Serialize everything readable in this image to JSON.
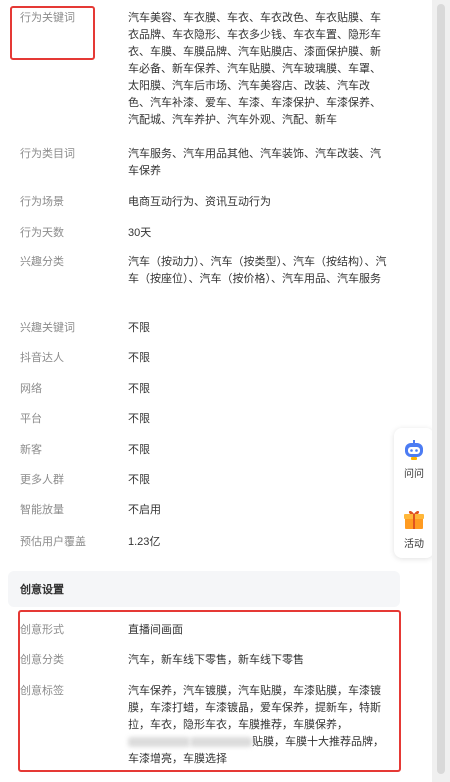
{
  "rows": [
    {
      "label": "行为关键词",
      "value": "汽车美容、车衣膜、车衣、车衣改色、车衣贴膜、车衣品牌、车衣隐形、车衣多少钱、车衣车置、隐形车衣、车膜、车膜品牌、汽车贴膜店、漆面保护膜、新车必备、新车保养、汽车贴膜、汽车玻璃膜、车罩、太阳膜、汽车后市场、汽车美容店、改装、汽车改色、汽车补漆、爱车、车漆、车漆保护、车漆保养、汽配城、汽车养护、汽车外观、汽配、新车"
    },
    {
      "label": "行为类目词",
      "value": "汽车服务、汽车用品其他、汽车装饰、汽车改装、汽车保养"
    },
    {
      "label": "行为场景",
      "value": "电商互动行为、资讯互动行为"
    },
    {
      "label": "行为天数",
      "value": "30天"
    },
    {
      "label": "兴趣分类",
      "value": "汽车（按动力）、汽车（按类型）、汽车（按结构）、汽车（按座位）、汽车（按价格）、汽车用品、汽车服务"
    },
    {
      "label": "兴趣关键词",
      "value": "不限"
    },
    {
      "label": "抖音达人",
      "value": "不限"
    },
    {
      "label": "网络",
      "value": "不限"
    },
    {
      "label": "平台",
      "value": "不限"
    },
    {
      "label": "新客",
      "value": "不限"
    },
    {
      "label": "更多人群",
      "value": "不限"
    },
    {
      "label": "智能放量",
      "value": "不启用"
    },
    {
      "label": "预估用户覆盖",
      "value": "1.23亿"
    }
  ],
  "creative_section": {
    "title": "创意设置",
    "rows": [
      {
        "label": "创意形式",
        "value": "直播间画面"
      },
      {
        "label": "创意分类",
        "value": "汽车，新车线下零售，新车线下零售"
      },
      {
        "label": "创意标签",
        "value_a": "汽车保养，汽车镀膜，汽车贴膜，车漆贴膜，车漆镀膜，车漆打蜡，车漆镀晶，爱车保养，提新车，特斯拉，车衣，隐形车衣，车膜推荐，车膜保养，",
        "value_b": "贴膜，车膜十大推荐品牌，车漆增亮，车膜选择"
      }
    ]
  },
  "float_panel": {
    "items": [
      {
        "label": "问问",
        "icon": "robot-assistant-icon"
      },
      {
        "label": "活动",
        "icon": "gift-icon"
      }
    ]
  },
  "colors": {
    "highlight": "#e53935",
    "label": "#8c8c8c",
    "text": "#333333"
  }
}
